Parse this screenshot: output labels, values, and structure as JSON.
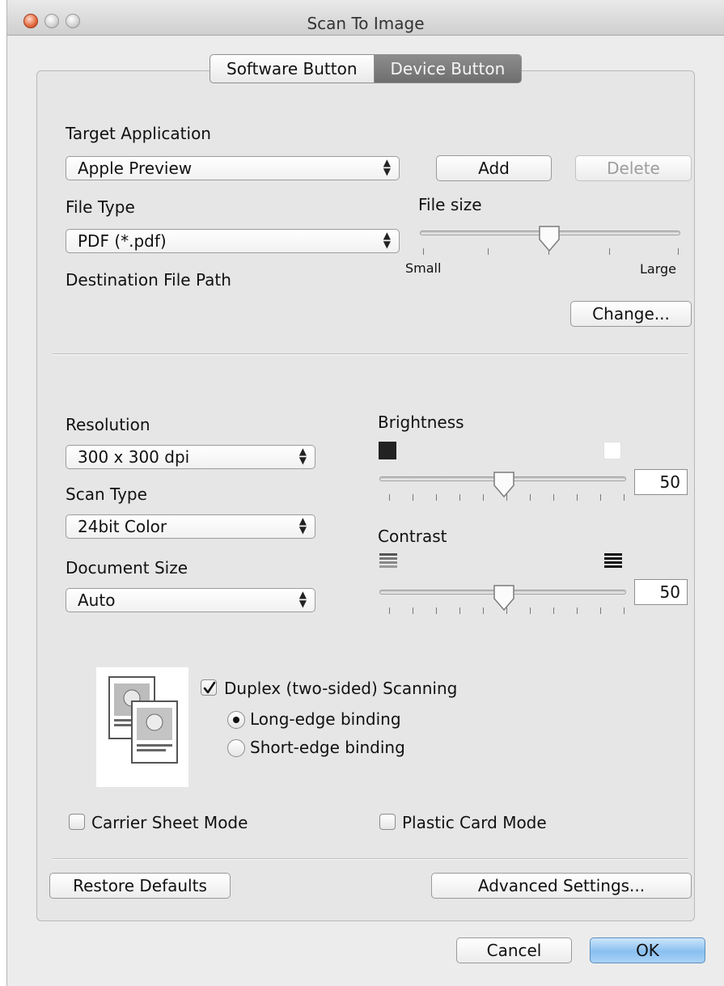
{
  "window": {
    "title": "Scan To Image"
  },
  "tabs": [
    {
      "label": "Software Button",
      "selected": false
    },
    {
      "label": "Device Button",
      "selected": true
    }
  ],
  "target_application": {
    "label": "Target Application",
    "value": "Apple Preview",
    "add_label": "Add",
    "delete_label": "Delete"
  },
  "file_type": {
    "label": "File Type",
    "value": "PDF (*.pdf)"
  },
  "file_size": {
    "label": "File size",
    "min_label": "Small",
    "max_label": "Large",
    "level": 0.62
  },
  "destination": {
    "label": "Destination File Path",
    "change_label": "Change..."
  },
  "resolution": {
    "label": "Resolution",
    "value": "300 x 300 dpi"
  },
  "scan_type": {
    "label": "Scan Type",
    "value": "24bit Color"
  },
  "document_size": {
    "label": "Document Size",
    "value": "Auto"
  },
  "brightness": {
    "label": "Brightness",
    "value": "50"
  },
  "contrast": {
    "label": "Contrast",
    "value": "50"
  },
  "duplex": {
    "label": "Duplex (two-sided) Scanning",
    "checked": true,
    "long_edge_label": "Long-edge binding",
    "short_edge_label": "Short-edge binding",
    "selected": "long"
  },
  "carrier_sheet": {
    "label": "Carrier Sheet Mode",
    "checked": false
  },
  "plastic_card": {
    "label": "Plastic Card Mode",
    "checked": false
  },
  "buttons": {
    "restore_defaults": "Restore Defaults",
    "advanced_settings": "Advanced Settings...",
    "cancel": "Cancel",
    "ok": "OK"
  },
  "icons": {
    "close": "close-icon",
    "minimize": "minimize-icon",
    "zoom": "zoom-icon",
    "popup_arrows": "updown-arrows-icon",
    "brightness_low": "dark-square-icon",
    "brightness_high": "light-square-icon",
    "contrast_low": "low-contrast-icon",
    "contrast_high": "high-contrast-icon",
    "checkmark": "checkmark-icon",
    "duplex_preview": "duplex-document-icon"
  },
  "colors": {
    "default_button": "#89bff0",
    "selected_tab": "#7a7a7a"
  }
}
